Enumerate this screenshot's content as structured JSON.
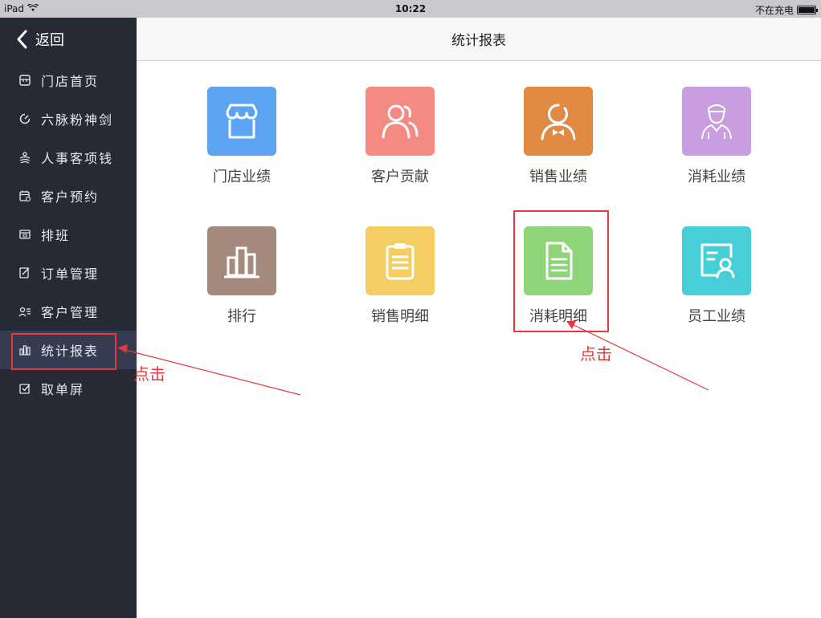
{
  "status": {
    "device": "iPad",
    "time": "10:22",
    "charge": "不在充电"
  },
  "sidebar": {
    "back_label": "返回",
    "items": [
      {
        "label": "门店首页",
        "icon": "store-icon"
      },
      {
        "label": "六脉粉神剑",
        "icon": "dashboard-icon"
      },
      {
        "label": "人事客项钱",
        "icon": "people-money-icon"
      },
      {
        "label": "客户预约",
        "icon": "calendar-icon"
      },
      {
        "label": "排班",
        "icon": "schedule-icon"
      },
      {
        "label": "订单管理",
        "icon": "order-edit-icon"
      },
      {
        "label": "客户管理",
        "icon": "customer-list-icon"
      },
      {
        "label": "统计报表",
        "icon": "bar-chart-icon",
        "active": true
      },
      {
        "label": "取单屏",
        "icon": "checkbox-icon"
      }
    ]
  },
  "header": {
    "title": "统计报表"
  },
  "tiles": [
    {
      "label": "门店业绩",
      "color": "#5ba4f3",
      "icon": "shop-icon"
    },
    {
      "label": "客户贡献",
      "color": "#f58a82",
      "icon": "customers-icon"
    },
    {
      "label": "销售业绩",
      "color": "#e08a43",
      "icon": "salesperson-icon"
    },
    {
      "label": "消耗业绩",
      "color": "#c89ee1",
      "icon": "worker-icon"
    },
    {
      "label": "排行",
      "color": "#a48a7d",
      "icon": "ranking-icon"
    },
    {
      "label": "销售明细",
      "color": "#f4cd63",
      "icon": "clipboard-icon"
    },
    {
      "label": "消耗明细",
      "color": "#90d47a",
      "icon": "document-icon"
    },
    {
      "label": "员工业绩",
      "color": "#46cfd6",
      "icon": "employee-card-icon"
    }
  ],
  "annotations": {
    "sidebar_note": "点击",
    "tile_note": "点击",
    "accent": "#e8383d"
  }
}
